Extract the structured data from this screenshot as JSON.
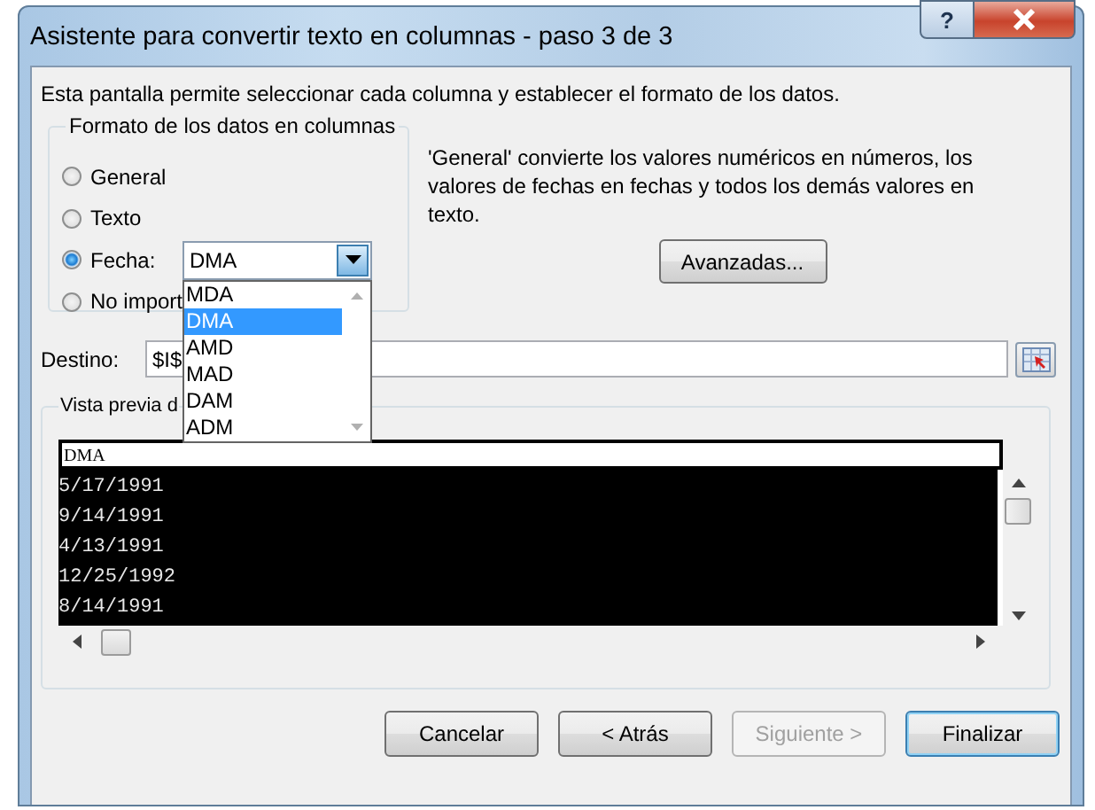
{
  "window": {
    "title": "Asistente para convertir texto en columnas - paso 3 de 3",
    "help": "?"
  },
  "intro": "Esta pantalla permite seleccionar cada columna y establecer el formato de los datos.",
  "format_group": {
    "legend": "Formato de los datos en columnas",
    "options": [
      {
        "label": "General",
        "kind": "plain",
        "selected": false
      },
      {
        "label": "Texto",
        "kind": "plain",
        "selected": false
      },
      {
        "label": "Fecha:",
        "kind": "date",
        "selected": true
      },
      {
        "label": "No import",
        "kind": "plain",
        "selected": false
      }
    ],
    "date_combo": {
      "value": "DMA",
      "expanded": true,
      "options": [
        {
          "label": "MDA",
          "selected": false
        },
        {
          "label": "DMA",
          "selected": true
        },
        {
          "label": "AMD",
          "selected": false
        },
        {
          "label": "MAD",
          "selected": false
        },
        {
          "label": "DAM",
          "selected": false
        },
        {
          "label": "ADM",
          "selected": false
        }
      ]
    }
  },
  "description": "'General' convierte los valores numéricos en números, los valores de fechas en fechas y todos los demás valores en texto.",
  "advanced_button": "Avanzadas...",
  "destination": {
    "label": "Destino:",
    "value": "$I$"
  },
  "preview": {
    "legend": "Vista previa d",
    "header": "DMA",
    "rows": [
      "5/17/1991",
      "9/14/1991",
      "4/13/1991",
      "12/25/1992",
      "8/14/1991"
    ]
  },
  "buttons": [
    {
      "label": "Cancelar",
      "disabled": false,
      "default": false
    },
    {
      "label": "< Atrás",
      "disabled": false,
      "default": false
    },
    {
      "label": "Siguiente >",
      "disabled": true,
      "default": false
    },
    {
      "label": "Finalizar",
      "disabled": false,
      "default": true
    }
  ]
}
